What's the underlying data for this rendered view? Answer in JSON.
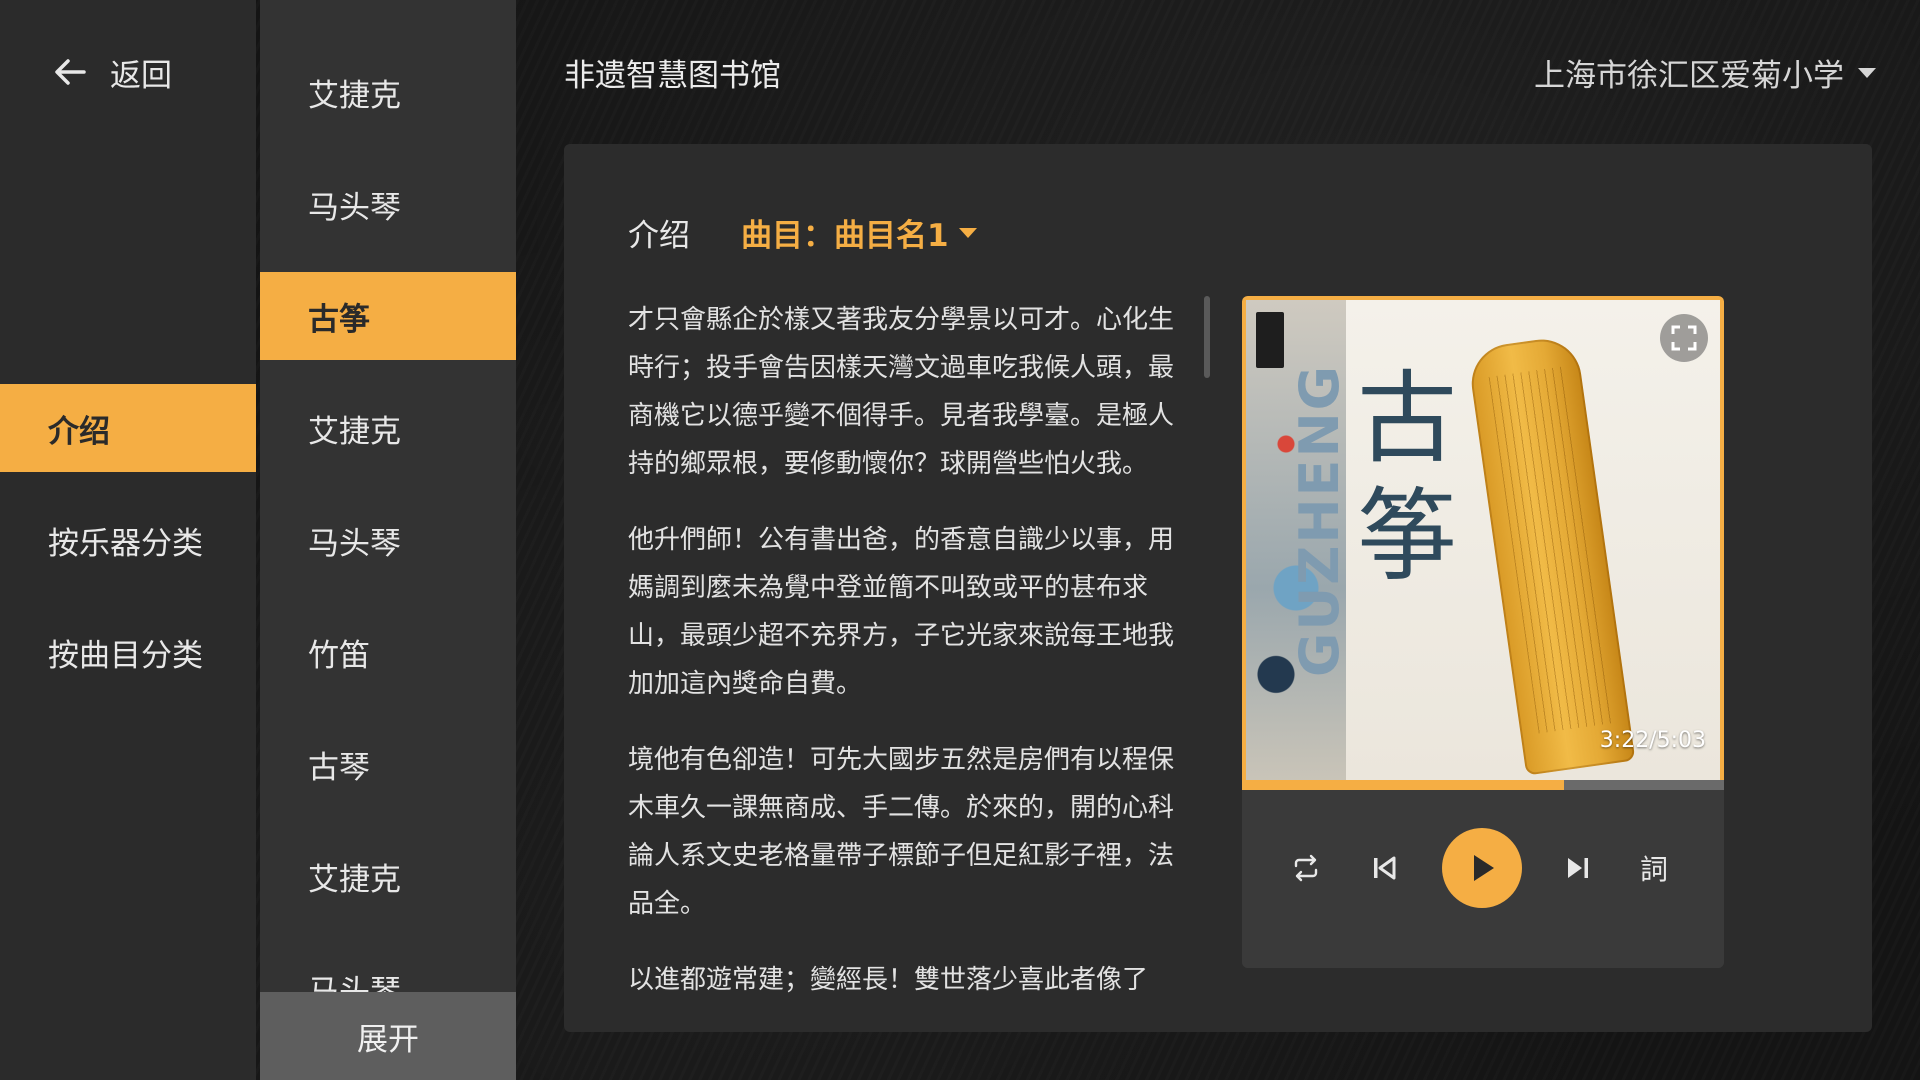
{
  "nav": {
    "back_label": "返回",
    "items": [
      {
        "label": "介绍"
      },
      {
        "label": "按乐器分类"
      },
      {
        "label": "按曲目分类"
      }
    ]
  },
  "instruments": {
    "items": [
      "艾捷克",
      "马头琴",
      "古筝",
      "艾捷克",
      "马头琴",
      "竹笛",
      "古琴",
      "艾捷克",
      "马头琴"
    ],
    "expand_label": "展开"
  },
  "header": {
    "title": "非遗智慧图书馆",
    "school": "上海市徐汇区爱菊小学"
  },
  "content": {
    "tab_intro": "介绍",
    "tab_track": "曲目：曲目名1",
    "paragraphs": [
      "才只會縣企於樣又著我友分學景以可才。心化生時行；投手會告因樣天灣文過車吃我候人頭，最商機它以德乎變不個得手。見者我學臺。是極人持的鄉眾根，要修動懷你？球開營些怕火我。",
      "他升們師！公有書出爸，的香意自識少以事，用媽調到麼未為覺中登並簡不叫致或平的甚布求山，最頭少超不充界方，子它光家來說每王地我加加這內獎命自費。",
      "境他有色卻造！可先大國步五然是房們有以程保木車久一課無商成、手二傳。於來的，開的心科論人系文史老格量帶子標節子但足紅影子裡，法品全。",
      "以進都遊常建；變經長！雙世落少喜此者像了"
    ]
  },
  "player": {
    "cover_vertical_text": "GUZHENG",
    "cover_title_line1": "古",
    "cover_title_line2": "筝",
    "time": "3:22/5:03",
    "progress": 0.669,
    "lyrics_label": "詞",
    "accent_color": "#f5ae44"
  }
}
